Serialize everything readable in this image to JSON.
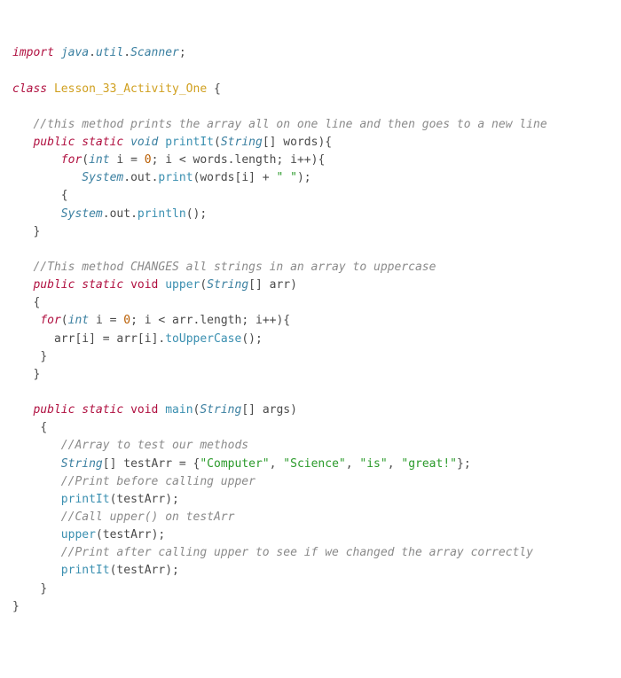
{
  "code": {
    "l1": {
      "kw": "import",
      "sp": " ",
      "pkg": "java",
      "d1": ".",
      "pkg2": "util",
      "d2": ".",
      "pkg3": "Scanner",
      "sc": ";"
    },
    "l3": {
      "kw": "class",
      "sp": " ",
      "name": "Lesson_33_Activity_One",
      "sp2": " ",
      "ob": "{"
    },
    "l5": {
      "cmt": "//this method prints the array all on one line and then goes to a new line"
    },
    "l6": {
      "pub": "public",
      "st": "static",
      "vd": "void",
      "fn": "printIt",
      "lp": "(",
      "ty": "String",
      "br": "[]",
      "sp": " ",
      "arg": "words",
      "rp": ")",
      "ob": "{"
    },
    "l7": {
      "kw": "for",
      "lp": "(",
      "ty": "int",
      "sp": " ",
      "v": "i",
      "eq": " = ",
      "n": "0",
      "sc": "; ",
      "v2": "i",
      "lt": " < ",
      "w": "words",
      "d": ".",
      "len": "length",
      "sc2": "; ",
      "v3": "i",
      "pp": "++",
      "rp": ")",
      "ob": "{"
    },
    "l8": {
      "sys": "System",
      "d1": ".",
      "out": "out",
      "d2": ".",
      "pr": "print",
      "lp": "(",
      "w": "words",
      "lb": "[",
      "i": "i",
      "rb": "]",
      "pl": " + ",
      "s": "\" \"",
      "rp": ")",
      "sc": ";"
    },
    "l9": {
      "ob": "{"
    },
    "l10": {
      "sys": "System",
      "d1": ".",
      "out": "out",
      "d2": ".",
      "pr": "println",
      "lp": "(",
      "rp": ")",
      "sc": ";"
    },
    "l11": {
      "cb": "}"
    },
    "l13": {
      "cmt": "//This method CHANGES all strings in an array to uppercase"
    },
    "l14": {
      "pub": "public",
      "st": "static",
      "vd": "void",
      "fn": "upper",
      "lp": "(",
      "ty": "String",
      "br": "[]",
      "sp": " ",
      "arg": "arr",
      "rp": ")"
    },
    "l15": {
      "ob": "{"
    },
    "l16": {
      "kw": "for",
      "lp": "(",
      "ty": "int",
      "sp": " ",
      "v": "i",
      "eq": " = ",
      "n": "0",
      "sc": "; ",
      "v2": "i",
      "lt": " < ",
      "a": "arr",
      "d": ".",
      "len": "length",
      "sc2": "; ",
      "v3": "i",
      "pp": "++",
      "rp": ")",
      "ob": "{"
    },
    "l17": {
      "a1": "arr",
      "lb1": "[",
      "i1": "i",
      "rb1": "]",
      "eq": " = ",
      "a2": "arr",
      "lb2": "[",
      "i2": "i",
      "rb2": "]",
      "d": ".",
      "fn": "toUpperCase",
      "lp": "(",
      "rp": ")",
      "sc": ";"
    },
    "l18": {
      "cb": "}"
    },
    "l19": {
      "cb": "}"
    },
    "l21": {
      "pub": "public",
      "st": "static",
      "vd": "void",
      "fn": "main",
      "lp": "(",
      "ty": "String",
      "br": "[]",
      "sp": " ",
      "arg": "args",
      "rp": ")"
    },
    "l22": {
      "ob": "{"
    },
    "l23": {
      "cmt": "//Array to test our methods"
    },
    "l24": {
      "ty": "String",
      "br": "[]",
      "sp": " ",
      "v": "testArr",
      "eq": " = ",
      "ob": "{",
      "s1": "\"Computer\"",
      "c1": ", ",
      "s2": "\"Science\"",
      "c2": ", ",
      "s3": "\"is\"",
      "c3": ", ",
      "s4": "\"great!\"",
      "cb": "}",
      "sc": ";"
    },
    "l25": {
      "cmt": "//Print before calling upper"
    },
    "l26": {
      "fn": "printIt",
      "lp": "(",
      "v": "testArr",
      "rp": ")",
      "sc": ";"
    },
    "l27": {
      "cmt": "//Call upper() on testArr"
    },
    "l28": {
      "fn": "upper",
      "lp": "(",
      "v": "testArr",
      "rp": ")",
      "sc": ";"
    },
    "l29": {
      "cmt": "//Print after calling upper to see if we changed the array correctly"
    },
    "l30": {
      "fn": "printIt",
      "lp": "(",
      "v": "testArr",
      "rp": ")",
      "sc": ";"
    },
    "l31": {
      "cb": "}"
    },
    "l32": {
      "cb": "}"
    }
  }
}
